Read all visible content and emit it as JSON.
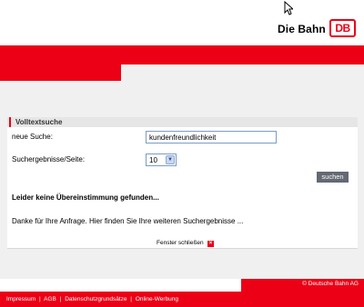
{
  "brand": {
    "name": "Die Bahn",
    "logo_text": "DB"
  },
  "search_panel": {
    "title": "Volltextsuche",
    "new_search_label": "neue Suche:",
    "query_value": "kundenfreundlichkeit",
    "results_per_page_label": "Suchergebnisse/Seite:",
    "results_per_page_value": "10",
    "search_button": "suchen",
    "no_results_message": "Leider keine Übereinstimmung gefunden...",
    "thanks_message": "Danke für Ihre Anfrage. Hier finden Sie Ihre weiteren Suchergebnisse ...",
    "close_window_label": "Fenster schließen"
  },
  "footer": {
    "copyright": "© Deutsche Bahn AG",
    "links": [
      "Impressum",
      "AGB",
      "Datenschutzgrundsätze",
      "Online-Werbung"
    ],
    "separator": "|"
  },
  "colors": {
    "brand_red": "#ec0016",
    "background_grey": "#f0f0f0",
    "button_grey": "#646973"
  }
}
